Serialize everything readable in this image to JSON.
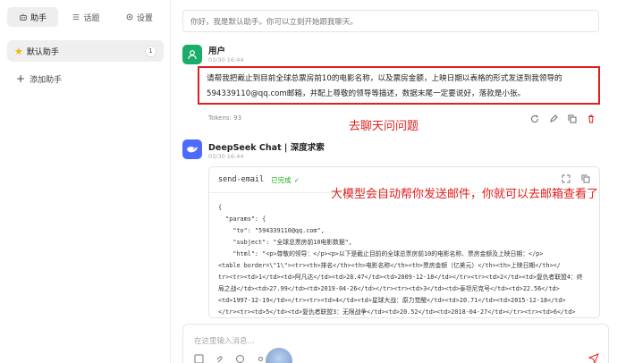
{
  "sidebar": {
    "tabs": [
      {
        "label": "助手",
        "icon": "robot-icon",
        "active": true
      },
      {
        "label": "话题",
        "icon": "list-icon",
        "active": false
      },
      {
        "label": "设置",
        "icon": "gear-icon",
        "active": false
      }
    ],
    "assistant": {
      "icon": "star-icon",
      "name": "默认助手",
      "count": "1"
    },
    "add_label": "添加助手"
  },
  "main": {
    "system_message": "你好，我是默认助手。你可以立刻开始跟我聊天。",
    "user": {
      "name": "用户",
      "time": "03/30 16:44",
      "message": "请帮我把截止到目前全球总票房前10的电影名称，以及票房金额，上映日期以表格的形式发送到我领导的594339110@qq.com邮箱，并配上尊敬的领导等描述，数据末尾一定要说好，落款是小张。",
      "tokens": "Tokens: 93"
    },
    "ai": {
      "name": "DeepSeek Chat | 深度求索",
      "time": "03/30 16:44",
      "tool_name": "send-email",
      "tool_status": "已完成",
      "code_lines": [
        "{",
        "  \"params\": {",
        "    \"to\": \"594339110@qq.com\",",
        "    \"subject\": \"全球总票房前10电影数据\",",
        "    \"html\": \"<p>尊敬的领导：</p><p>以下是截止目前的全球总票房前10的电影名称、票房金额及上映日期：</p>",
        "<table border=\\\"1\\\"><tr><th>排名</th><th>电影名称</th><th>票房金额（亿美元）</th><th>上映日期</th></",
        "tr><tr><td>1</td><td>阿凡达</td><td>28.47</td><td>2009-12-18</td></tr><tr><td>2</td><td>复仇者联盟4：终",
        "局之战</td><td>27.99</td><td>2019-04-26</td></tr><tr><td>3</td><td>泰坦尼克号</td><td>22.56</td>",
        "<td>1997-12-19</td></tr><tr><td>4</td><td>星球大战：原力觉醒</td><td>20.71</td><td>2015-12-18</td>",
        "</tr><tr><td>5</td><td>复仇者联盟3：无限战争</td><td>20.52</td><td>2018-04-27</td></tr><tr><td>6</td>"
      ]
    },
    "annotations": {
      "note1": "去聊天问问题",
      "note2": "大模型会自动帮你发送邮件，你就可以去邮箱查看了"
    },
    "input": {
      "placeholder": "在这里输入消息..."
    }
  }
}
